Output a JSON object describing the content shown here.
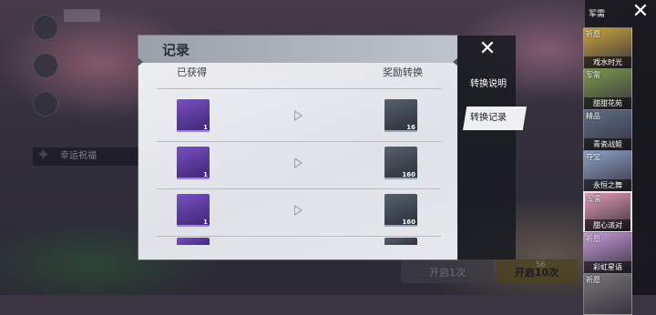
{
  "modal": {
    "title": "记录",
    "col_obtained": "已获得",
    "col_reward": "奖励转换",
    "tabs": [
      {
        "label": "转换说明",
        "active": false
      },
      {
        "label": "转换记录",
        "active": true
      }
    ],
    "rows": [
      {
        "item_icon": "pink-rifle-icon",
        "item_qty": "1",
        "reward_icon": "green-token-icon",
        "reward_qty": "16"
      },
      {
        "item_icon": "bunny-ear-accessory-icon",
        "item_qty": "1",
        "reward_icon": "bronze-coin-icon",
        "reward_qty": "160"
      },
      {
        "item_icon": "pink-helmet-icon",
        "item_qty": "1",
        "reward_icon": "bronze-coin-icon",
        "reward_qty": "160"
      }
    ]
  },
  "background": {
    "banner_text": "幸运祝福",
    "button_open_1": "开启1次",
    "button_open_10": "开启10次",
    "cost_10": "56"
  },
  "sidebar": {
    "top_label": "军需",
    "cards": [
      {
        "tag": "祈愿",
        "name": "戏水时光",
        "active": false,
        "color": "#c9a53a"
      },
      {
        "tag": "军需",
        "name": "甜甜花苑",
        "active": false,
        "color": "#7a9a4a"
      },
      {
        "tag": "精品",
        "name": "青瓷战姬",
        "active": false,
        "color": "#5a6f86"
      },
      {
        "tag": "夺宝",
        "name": "永恒之舞",
        "active": false,
        "color": "#8aa3c7"
      },
      {
        "tag": "军需",
        "name": "甜心派对",
        "active": true,
        "color": "#e59ab5"
      },
      {
        "tag": "祈愿",
        "name": "彩虹星语",
        "active": false,
        "color": "#c69ad8"
      },
      {
        "tag": "祈愿",
        "name": "",
        "active": false,
        "color": "#777"
      }
    ]
  }
}
